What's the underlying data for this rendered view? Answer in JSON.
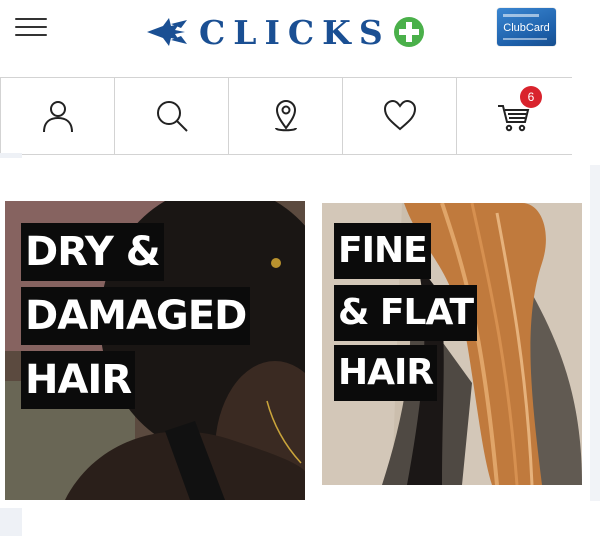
{
  "header": {
    "menu_icon": "hamburger-menu-icon",
    "logo_text": "CLICKS",
    "clubcard_label": "ClubCard",
    "brand_color": "#1a4f93",
    "plus_color": "#4ab04a"
  },
  "nav": {
    "items": [
      {
        "name": "account",
        "icon": "user-icon"
      },
      {
        "name": "search",
        "icon": "search-icon"
      },
      {
        "name": "store-locator",
        "icon": "location-pin-icon"
      },
      {
        "name": "wishlist",
        "icon": "heart-icon"
      },
      {
        "name": "cart",
        "icon": "cart-icon"
      }
    ],
    "cart_count": "6",
    "badge_color": "#d9232d"
  },
  "promos": [
    {
      "lines": [
        "DRY &",
        "DAMAGED",
        "HAIR"
      ]
    },
    {
      "lines": [
        "FINE",
        "& FLAT",
        "HAIR"
      ]
    }
  ]
}
